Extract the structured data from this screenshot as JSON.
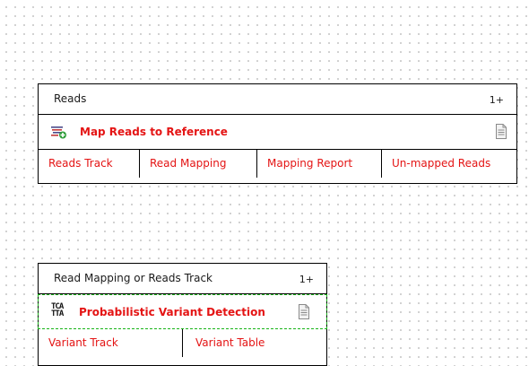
{
  "workflow": {
    "box1": {
      "input_label": "Reads",
      "multiplicity": "1+",
      "tool_name": "Map Reads to Reference",
      "tool_icon": "map-reads-icon",
      "outputs": [
        "Reads Track",
        "Read Mapping",
        "Mapping Report",
        "Un-mapped Reads"
      ]
    },
    "box2": {
      "input_label": "Read Mapping or Reads Track",
      "multiplicity": "1+",
      "tool_name": "Probabilistic Variant Detection",
      "tool_icon_text_top": "TCA",
      "tool_icon_text_bottom": "TTA",
      "outputs": [
        "Variant Track",
        "Variant Table"
      ]
    }
  },
  "colors": {
    "tool_text": "#e41414",
    "selection_border": "#18b418",
    "grid_dot": "#c6c6c6"
  }
}
